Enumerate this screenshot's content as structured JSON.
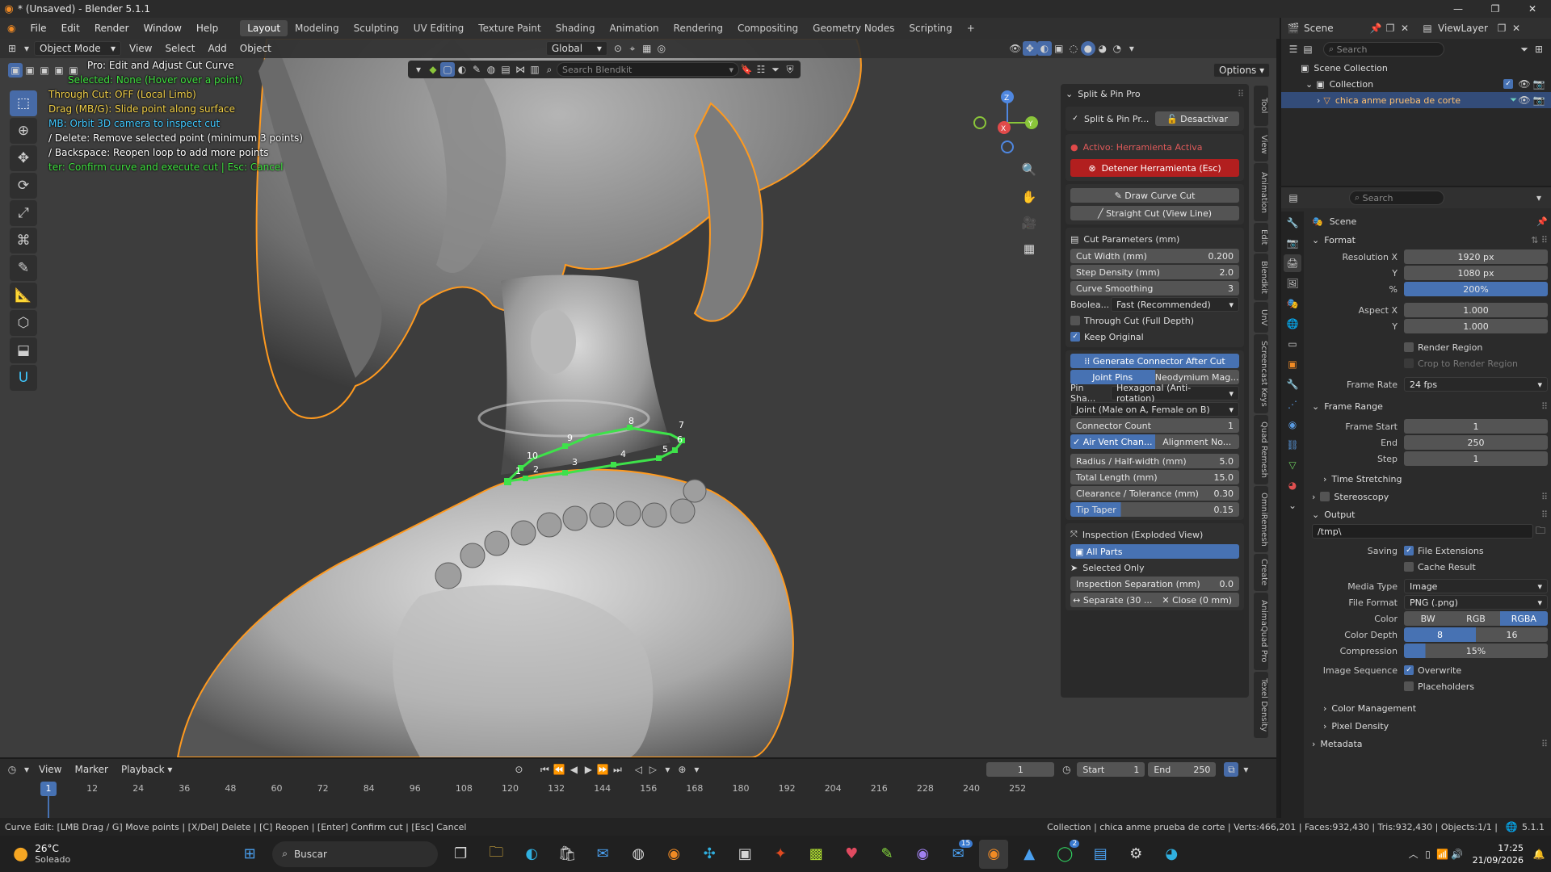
{
  "app": {
    "title": "* (Unsaved) - Blender 5.1.1"
  },
  "menu": [
    "File",
    "Edit",
    "Render",
    "Window",
    "Help"
  ],
  "workspaces": [
    "Layout",
    "Modeling",
    "Sculpting",
    "UV Editing",
    "Texture Paint",
    "Shading",
    "Animation",
    "Rendering",
    "Compositing",
    "Geometry Nodes",
    "Scripting"
  ],
  "workspace_active": "Layout",
  "scene_name": "Scene",
  "viewlayer_name": "ViewLayer",
  "viewport": {
    "mode": "Object Mode",
    "menus": [
      "View",
      "Select",
      "Add",
      "Object"
    ],
    "transform": "Global",
    "search_placeholder": "Search Blendkit",
    "options": "Options",
    "hints": [
      {
        "text": "Pro: Edit and Adjust Cut Curve",
        "color": "#ffffff"
      },
      {
        "text": "Selected: None (Hover over a point)",
        "color": "#40e040"
      },
      {
        "text": "Through Cut: OFF (Local Limb)",
        "color": "#f2d048"
      },
      {
        "text": "Drag (MB/G): Slide point along surface",
        "color": "#f2d048"
      },
      {
        "text": "MB: Orbit 3D camera to inspect cut",
        "color": "#3fc8ff"
      },
      {
        "text": "/ Delete: Remove selected point (minimum 3 points)",
        "color": "#ffffff"
      },
      {
        "text": "/ Backspace: Reopen loop to add more points",
        "color": "#ffffff"
      },
      {
        "text": "ter: Confirm curve and execute cut  |  Esc: Cancel",
        "color": "#40e040"
      }
    ],
    "curve_point_labels": [
      "1",
      "2",
      "3",
      "4",
      "5",
      "6",
      "7",
      "8",
      "9",
      "10"
    ]
  },
  "npanel": {
    "title": "Split & Pin Pro",
    "addon_label": "Split & Pin Pr...",
    "deactivate": "Desactivar",
    "active_status": "Activo: Herramienta Activa",
    "stop_tool": "Detener Herramienta (Esc)",
    "draw_curve": "Draw Curve Cut",
    "straight_cut": "Straight Cut (View Line)",
    "cut_params_title": "Cut Parameters (mm)",
    "params": [
      {
        "label": "Cut Width (mm)",
        "value": "0.200"
      },
      {
        "label": "Step Density (mm)",
        "value": "2.0"
      },
      {
        "label": "Curve Smoothing",
        "value": "3"
      }
    ],
    "boolean_label": "Boolea...",
    "boolean_value": "Fast (Recommended)",
    "through_cut": "Through Cut (Full Depth)",
    "keep_original": "Keep Original",
    "generate_connector": "Generate Connector After Cut",
    "joint_pins": "Joint Pins",
    "neodymium": "Neodymium Mag...",
    "pin_shape_label": "Pin Sha...",
    "pin_shape_value": "Hexagonal (Anti-rotation)",
    "joint_value": "Joint (Male on A, Female on B)",
    "connector_count_label": "Connector Count",
    "connector_count": "1",
    "air_vent": "Air Vent Chan...",
    "alignment": "Alignment No...",
    "dims": [
      {
        "label": "Radius / Half-width (mm)",
        "value": "5.0"
      },
      {
        "label": "Total Length (mm)",
        "value": "15.0"
      },
      {
        "label": "Clearance / Tolerance (mm)",
        "value": "0.30"
      },
      {
        "label": "Tip Taper",
        "value": "0.15"
      }
    ],
    "inspection_title": "Inspection (Exploded View)",
    "all_parts": "All Parts",
    "selected_only": "Selected Only",
    "inspection_sep_label": "Inspection Separation (mm)",
    "inspection_sep": "0.0",
    "separate": "Separate (30 ...",
    "close": "Close (0 mm)"
  },
  "vtabs": [
    "Tool",
    "View",
    "Animation",
    "Edit",
    "Blendkit",
    "UnV",
    "Screencast Keys",
    "Quad Remesh",
    "OmniRemesh",
    "Create",
    "AnimaQuad Pro",
    "Texel Density"
  ],
  "outliner": {
    "search_placeholder": "Search",
    "scene_collection": "Scene Collection",
    "collection": "Collection",
    "object": "chica anme prueba de corte"
  },
  "properties": {
    "search_placeholder": "Search",
    "scene": "Scene",
    "format_title": "Format",
    "resolution_x_label": "Resolution X",
    "resolution_x": "1920 px",
    "y_label": "Y",
    "resolution_y": "1080 px",
    "pct_label": "%",
    "resolution_pct": "200%",
    "aspect_x_label": "Aspect X",
    "aspect_x": "1.000",
    "aspect_y": "1.000",
    "render_region": "Render Region",
    "crop_region": "Crop to Render Region",
    "frame_rate_label": "Frame Rate",
    "frame_rate": "24 fps",
    "frame_range_title": "Frame Range",
    "frame_start_label": "Frame Start",
    "frame_start": "1",
    "end_label": "End",
    "frame_end": "250",
    "step_label": "Step",
    "frame_step": "1",
    "time_stretching": "Time Stretching",
    "stereoscopy": "Stereoscopy",
    "output_title": "Output",
    "output_path": "/tmp\\",
    "saving_label": "Saving",
    "file_extensions": "File Extensions",
    "cache_result": "Cache Result",
    "media_type_label": "Media Type",
    "media_type": "Image",
    "file_format_label": "File Format",
    "file_format": "PNG (.png)",
    "color_label": "Color",
    "color_opts": [
      "BW",
      "RGB",
      "RGBA"
    ],
    "color_depth_label": "Color Depth",
    "color_depth_opts": [
      "8",
      "16"
    ],
    "compression_label": "Compression",
    "compression": "15%",
    "image_sequence_label": "Image Sequence",
    "overwrite": "Overwrite",
    "placeholders": "Placeholders",
    "color_management": "Color Management",
    "pixel_density": "Pixel Density",
    "metadata": "Metadata"
  },
  "timeline": {
    "menus": [
      "View",
      "Marker",
      "Playback"
    ],
    "current_frame": "1",
    "start_label": "Start",
    "start": "1",
    "end_label": "End",
    "end": "250",
    "ticks": [
      "1",
      "12",
      "24",
      "36",
      "48",
      "60",
      "72",
      "84",
      "96",
      "108",
      "120",
      "132",
      "144",
      "156",
      "168",
      "180",
      "192",
      "204",
      "216",
      "228",
      "240",
      "252"
    ]
  },
  "status": {
    "left": "Curve Edit: [LMB Drag / G] Move points | [X/Del] Delete | [C] Reopen | [Enter] Confirm cut | [Esc] Cancel",
    "right": "Collection | chica anme prueba de corte | Verts:466,201 | Faces:932,430 | Tris:932,430 | Objects:1/1 |",
    "version": "5.1.1"
  },
  "taskbar": {
    "temp": "26°C",
    "weather": "Soleado",
    "search": "Buscar",
    "time": "17:25",
    "date": "21/09/2026",
    "badges": {
      "outlook": "15",
      "whatsapp": "2"
    }
  }
}
